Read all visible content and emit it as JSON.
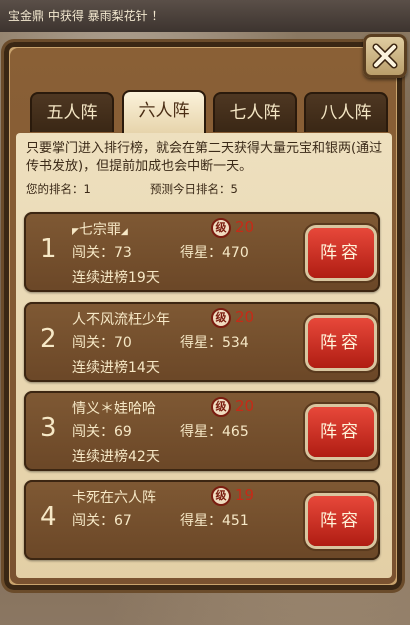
{
  "ticker": {
    "text": "宝金鼎 中获得 暴雨梨花针 ！"
  },
  "tabs": [
    {
      "label": "五人阵",
      "active": false
    },
    {
      "label": "六人阵",
      "active": true
    },
    {
      "label": "七人阵",
      "active": false
    },
    {
      "label": "八人阵",
      "active": false
    }
  ],
  "info": {
    "description": "只要掌门进入排行榜，就会在第二天获得大量元宝和银两(通过传书发放)，但提前加成也会中断一天。",
    "my_rank_label": "您的排名：",
    "my_rank_value": "1",
    "forecast_label": "预测今日排名：",
    "forecast_value": "5"
  },
  "labels": {
    "pass_label": "闯关：",
    "star_label": "得星：",
    "lineup_button": "阵容",
    "level_icon_char": "级"
  },
  "rows": [
    {
      "rank": "1",
      "name": "七宗罪",
      "decorated": true,
      "level": "20",
      "pass": "73",
      "stars": "470",
      "streak": "连续进榜19天"
    },
    {
      "rank": "2",
      "name": "人不风流枉少年",
      "decorated": false,
      "level": "20",
      "pass": "70",
      "stars": "534",
      "streak": "连续进榜14天"
    },
    {
      "rank": "3",
      "name": "情义＊娃哈哈",
      "decorated": false,
      "level": "20",
      "pass": "69",
      "stars": "465",
      "streak": "连续进榜42天"
    },
    {
      "rank": "4",
      "name": "卡死在六人阵",
      "decorated": false,
      "level": "19",
      "pass": "67",
      "stars": "451",
      "streak": ""
    }
  ],
  "colors": {
    "level_value": "#c62a17",
    "button_red": "#d33526",
    "panel_brown": "#7a5230"
  },
  "icons": {
    "close": "close-icon",
    "level": "level-badge-icon"
  }
}
